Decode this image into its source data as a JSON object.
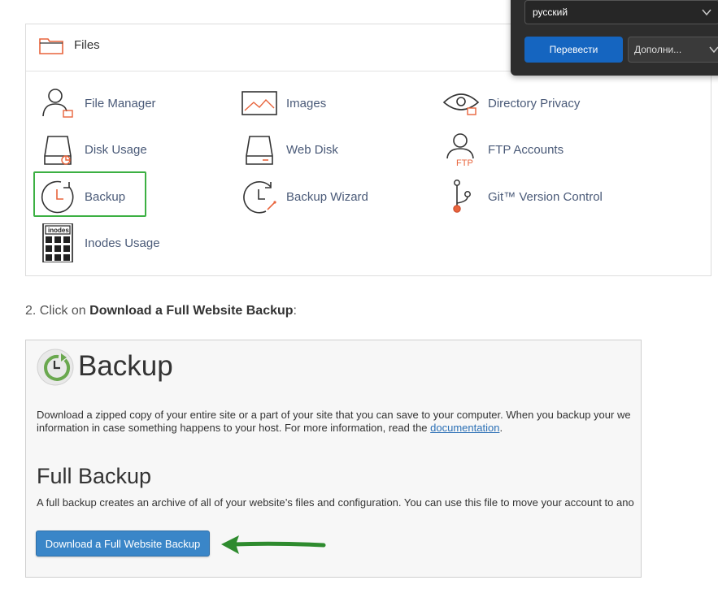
{
  "files_panel": {
    "title": "Files",
    "items": [
      {
        "label": "File Manager",
        "icon": "file-manager-icon"
      },
      {
        "label": "Images",
        "icon": "images-icon"
      },
      {
        "label": "Directory Privacy",
        "icon": "directory-privacy-icon"
      },
      {
        "label": "Disk Usage",
        "icon": "disk-usage-icon"
      },
      {
        "label": "Web Disk",
        "icon": "web-disk-icon"
      },
      {
        "label": "FTP Accounts",
        "icon": "ftp-accounts-icon"
      },
      {
        "label": "Backup",
        "icon": "backup-icon"
      },
      {
        "label": "Backup Wizard",
        "icon": "backup-wizard-icon"
      },
      {
        "label": "Git™ Version Control",
        "icon": "git-icon"
      },
      {
        "label": "Inodes Usage",
        "icon": "inodes-icon"
      }
    ],
    "inodes_icon_text": "inodes",
    "ftp_icon_text": "FTP"
  },
  "step": {
    "prefix": "2. Click on ",
    "bold": "Download a Full Website Backup",
    "suffix": ":"
  },
  "backup_page": {
    "title": "Backup",
    "desc_line1": "Download a zipped copy of your entire site or a part of your site that you can save to your computer. When you backup your we",
    "desc_line2_prefix": "information in case something happens to your host. For more information, read the ",
    "desc_link": "documentation",
    "desc_line2_suffix": ".",
    "full_backup_title": "Full Backup",
    "full_backup_desc": "A full backup creates an archive of all of your website’s files and configuration. You can use this file to move your account to ano",
    "download_button": "Download a Full Website Backup"
  },
  "translate_popup": {
    "language": "русский",
    "translate_button": "Перевести",
    "more_button": "Дополни..."
  },
  "colors": {
    "highlight": "#3cb043",
    "arrow": "#2e8b2e",
    "button": "#3a86c8",
    "link": "#2a6fb5",
    "icon_accent": "#e8643c"
  }
}
